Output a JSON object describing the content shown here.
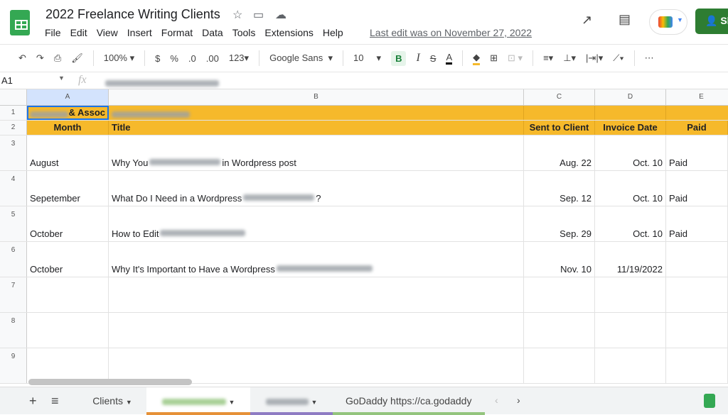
{
  "doc": {
    "title": "2022 Freelance Writing Clients",
    "last_edit": "Last edit was on November 27, 2022",
    "share_label": "Sh"
  },
  "menu": [
    "File",
    "Edit",
    "View",
    "Insert",
    "Format",
    "Data",
    "Tools",
    "Extensions",
    "Help"
  ],
  "toolbar": {
    "zoom": "100%",
    "currency": "$",
    "percent": "%",
    "dec_less": ".0",
    "dec_more": ".00",
    "format": "123",
    "font": "Google Sans",
    "size": "10",
    "bold": "B",
    "italic": "I",
    "strike": "S",
    "text_color": "A",
    "more": "⋯"
  },
  "formula": {
    "cell_ref": "A1",
    "fx": "fx"
  },
  "columns": [
    "A",
    "B",
    "C",
    "D",
    "E"
  ],
  "rows": {
    "r1": {
      "num": "1",
      "a": "& Assoc"
    },
    "r2": {
      "num": "2",
      "month": "Month",
      "title": "Title",
      "sent": "Sent to Client",
      "invoice": "Invoice Date",
      "paid": "Paid"
    },
    "data": [
      {
        "num": "3",
        "month": "August",
        "title_a": "Why You",
        "title_b": "in Wordpress post",
        "sent": "Aug. 22",
        "invoice": "Oct. 10",
        "paid": "Paid"
      },
      {
        "num": "4",
        "month": "Sepetember",
        "title_a": "What Do I Need in a Wordpress",
        "title_b": "?",
        "sent": "Sep. 12",
        "invoice": "Oct. 10",
        "paid": "Paid"
      },
      {
        "num": "5",
        "month": "October",
        "title_a": "How to Edit",
        "title_b": "",
        "sent": "Sep. 29",
        "invoice": "Oct. 10",
        "paid": "Paid"
      },
      {
        "num": "6",
        "month": "October",
        "title_a": "Why It's Important to Have a Wordpress",
        "title_b": "",
        "sent": "Nov. 10",
        "invoice": "11/19/2022",
        "paid": ""
      }
    ],
    "empty": [
      "7",
      "8",
      "9"
    ]
  },
  "tabs": {
    "add": "+",
    "list": "≡",
    "clients": "Clients",
    "godaddy": "GoDaddy https://ca.godaddy"
  },
  "colors": {
    "header": "#f6b92b",
    "share": "#2e7d32",
    "tab_orange": "#e69138",
    "tab_purple": "#8e7cc3",
    "tab_green": "#93c47d"
  }
}
